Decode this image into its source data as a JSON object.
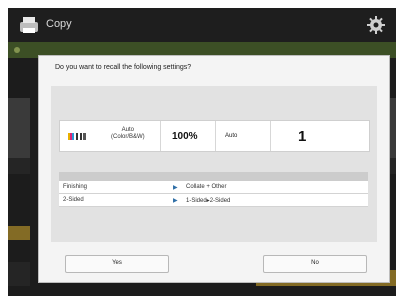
{
  "app": {
    "title": "Copy"
  },
  "dialog": {
    "title": "Do you want to recall the following settings?",
    "summary": {
      "color_mode": "Auto\n(Color/B&W)",
      "ratio": "100%",
      "paper": "Auto",
      "copies": "1"
    },
    "settings": [
      {
        "label": "Finishing",
        "value": "Collate + Other"
      },
      {
        "label": "2-Sided",
        "value": "1-Sided▸2-Sided"
      }
    ],
    "yes_label": "Yes",
    "no_label": "No"
  },
  "icons": {
    "app": "copy-machine-icon",
    "gear": "gear-icon",
    "color": "color-bw-icon",
    "arrow": "arrow-right-icon"
  },
  "colors": {
    "topbar": "#1e1e1e",
    "status": "#5c7a3a",
    "accent_yellow": "#c9a53a",
    "dialog_bg": "#f4f4f4"
  }
}
